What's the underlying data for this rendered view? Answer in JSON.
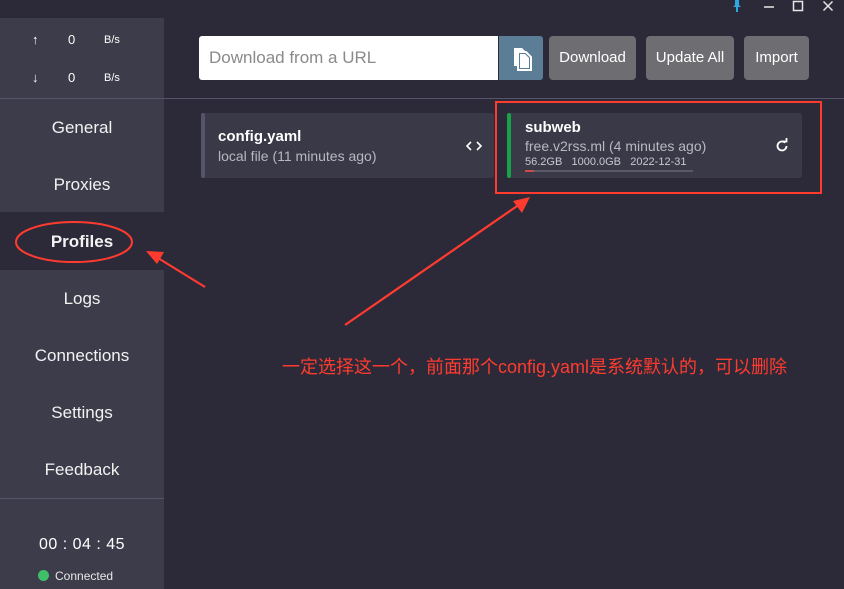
{
  "window": {
    "pin_icon": "pin-icon",
    "min_icon": "minimize-icon",
    "max_icon": "maximize-icon",
    "close_icon": "close-icon"
  },
  "traffic": {
    "up_arrow": "↑",
    "up_value": "0",
    "up_unit": "B/s",
    "down_arrow": "↓",
    "down_value": "0",
    "down_unit": "B/s"
  },
  "nav": {
    "items": [
      {
        "label": "General"
      },
      {
        "label": "Proxies"
      },
      {
        "label": "Profiles"
      },
      {
        "label": "Logs"
      },
      {
        "label": "Connections"
      },
      {
        "label": "Settings"
      },
      {
        "label": "Feedback"
      }
    ],
    "active": "Profiles"
  },
  "footer": {
    "uptime": "00 : 04 : 45",
    "status": "Connected",
    "status_color": "#3fbf6a"
  },
  "toolbar": {
    "url_placeholder": "Download from a URL",
    "paste_icon": "clipboard-paste-icon",
    "download_label": "Download",
    "update_all_label": "Update All",
    "import_label": "Import"
  },
  "profiles": [
    {
      "name": "config.yaml",
      "subtitle": "local file (11 minutes ago)",
      "action_icon": "code-icon",
      "action_glyph": "‹›",
      "active": false,
      "bar_color": "#55546a"
    },
    {
      "name": "subweb",
      "subtitle": "free.v2rss.ml (4 minutes ago)",
      "used": "56.2GB",
      "total": "1000.0GB",
      "expire": "2022-12-31",
      "usage_fraction": 0.056,
      "action_icon": "refresh-icon",
      "action_glyph": "↻",
      "active": true,
      "bar_color": "#16a34a"
    }
  ],
  "annotation": {
    "text": "一定选择这一个，前面那个config.yaml是系统默认的，可以删除",
    "color": "#ff3b30"
  }
}
